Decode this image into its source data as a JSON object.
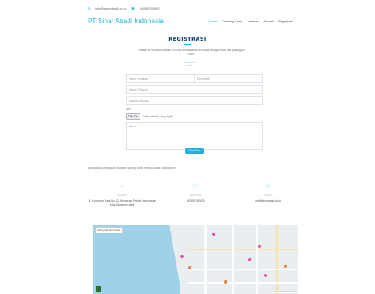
{
  "topbar": {
    "email": "info@sinarabadi.co.id",
    "phone": "+6285255525"
  },
  "brand": "PT Sinar Abadi Indonesia",
  "nav": [
    "Home",
    "Tentang Kami",
    "Layanan",
    "Kontak",
    "Registrasi"
  ],
  "form": {
    "title": "REGISTRASI",
    "intro": "Silakan isi formulir di bawah ini untuk mendaftarkan diri Anda sebagai mitra atau pelanggan kami.",
    "intro_small": "Isi data",
    "name_placeholder": "Nama Lengkap",
    "email_placeholder": "Email Aktif",
    "phone_placeholder": "Nomor Telepon",
    "address_placeholder": "Alamat Lengkap",
    "file_label": "KTP",
    "file_button": "Pilih File",
    "file_status": "Tidak ada file yang dipilih",
    "message_placeholder": "Pesan",
    "submit": "Kirim Data"
  },
  "note": "Apabila ada pertanyaan, silahkan hubungi kami melalui kontak di bawah ini.",
  "contact": {
    "address_label": "ALAMAT",
    "address_value": "Jl. Boulevard Raya No. 12, Kelurahan Pesisir, Kecamatan Kota, Sulawesi Utara",
    "phone_label": "TELEPON",
    "phone_value": "+62 852 5552 5",
    "email_label": "EMAIL",
    "email_value": "info@sinarabadi.co.id"
  },
  "map": {
    "badge": "Lihat peta lebih besar",
    "footer": "Data peta ©2024 Google"
  },
  "colors": {
    "accent": "#1bb1dc",
    "title": "#0a3c6e"
  }
}
